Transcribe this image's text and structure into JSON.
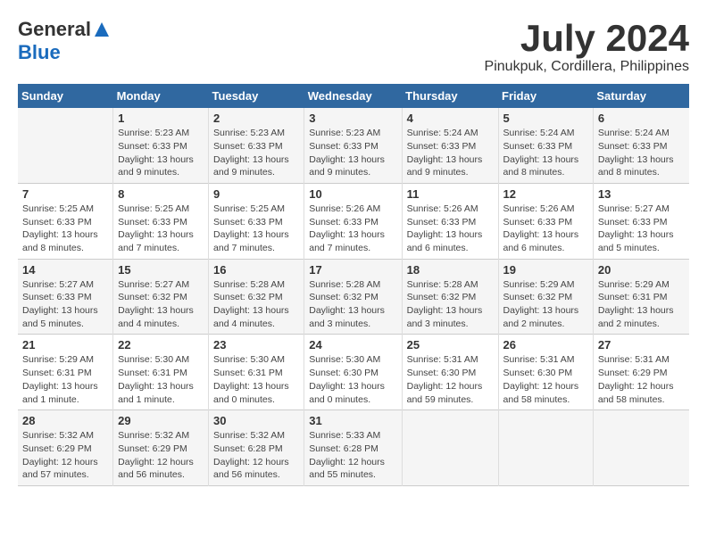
{
  "header": {
    "logo_general": "General",
    "logo_blue": "Blue",
    "month_title": "July 2024",
    "location": "Pinukpuk, Cordillera, Philippines"
  },
  "days_of_week": [
    "Sunday",
    "Monday",
    "Tuesday",
    "Wednesday",
    "Thursday",
    "Friday",
    "Saturday"
  ],
  "weeks": [
    [
      {
        "day": "",
        "info": ""
      },
      {
        "day": "1",
        "info": "Sunrise: 5:23 AM\nSunset: 6:33 PM\nDaylight: 13 hours\nand 9 minutes."
      },
      {
        "day": "2",
        "info": "Sunrise: 5:23 AM\nSunset: 6:33 PM\nDaylight: 13 hours\nand 9 minutes."
      },
      {
        "day": "3",
        "info": "Sunrise: 5:23 AM\nSunset: 6:33 PM\nDaylight: 13 hours\nand 9 minutes."
      },
      {
        "day": "4",
        "info": "Sunrise: 5:24 AM\nSunset: 6:33 PM\nDaylight: 13 hours\nand 9 minutes."
      },
      {
        "day": "5",
        "info": "Sunrise: 5:24 AM\nSunset: 6:33 PM\nDaylight: 13 hours\nand 8 minutes."
      },
      {
        "day": "6",
        "info": "Sunrise: 5:24 AM\nSunset: 6:33 PM\nDaylight: 13 hours\nand 8 minutes."
      }
    ],
    [
      {
        "day": "7",
        "info": "Sunrise: 5:25 AM\nSunset: 6:33 PM\nDaylight: 13 hours\nand 8 minutes."
      },
      {
        "day": "8",
        "info": "Sunrise: 5:25 AM\nSunset: 6:33 PM\nDaylight: 13 hours\nand 7 minutes."
      },
      {
        "day": "9",
        "info": "Sunrise: 5:25 AM\nSunset: 6:33 PM\nDaylight: 13 hours\nand 7 minutes."
      },
      {
        "day": "10",
        "info": "Sunrise: 5:26 AM\nSunset: 6:33 PM\nDaylight: 13 hours\nand 7 minutes."
      },
      {
        "day": "11",
        "info": "Sunrise: 5:26 AM\nSunset: 6:33 PM\nDaylight: 13 hours\nand 6 minutes."
      },
      {
        "day": "12",
        "info": "Sunrise: 5:26 AM\nSunset: 6:33 PM\nDaylight: 13 hours\nand 6 minutes."
      },
      {
        "day": "13",
        "info": "Sunrise: 5:27 AM\nSunset: 6:33 PM\nDaylight: 13 hours\nand 5 minutes."
      }
    ],
    [
      {
        "day": "14",
        "info": "Sunrise: 5:27 AM\nSunset: 6:33 PM\nDaylight: 13 hours\nand 5 minutes."
      },
      {
        "day": "15",
        "info": "Sunrise: 5:27 AM\nSunset: 6:32 PM\nDaylight: 13 hours\nand 4 minutes."
      },
      {
        "day": "16",
        "info": "Sunrise: 5:28 AM\nSunset: 6:32 PM\nDaylight: 13 hours\nand 4 minutes."
      },
      {
        "day": "17",
        "info": "Sunrise: 5:28 AM\nSunset: 6:32 PM\nDaylight: 13 hours\nand 3 minutes."
      },
      {
        "day": "18",
        "info": "Sunrise: 5:28 AM\nSunset: 6:32 PM\nDaylight: 13 hours\nand 3 minutes."
      },
      {
        "day": "19",
        "info": "Sunrise: 5:29 AM\nSunset: 6:32 PM\nDaylight: 13 hours\nand 2 minutes."
      },
      {
        "day": "20",
        "info": "Sunrise: 5:29 AM\nSunset: 6:31 PM\nDaylight: 13 hours\nand 2 minutes."
      }
    ],
    [
      {
        "day": "21",
        "info": "Sunrise: 5:29 AM\nSunset: 6:31 PM\nDaylight: 13 hours\nand 1 minute."
      },
      {
        "day": "22",
        "info": "Sunrise: 5:30 AM\nSunset: 6:31 PM\nDaylight: 13 hours\nand 1 minute."
      },
      {
        "day": "23",
        "info": "Sunrise: 5:30 AM\nSunset: 6:31 PM\nDaylight: 13 hours\nand 0 minutes."
      },
      {
        "day": "24",
        "info": "Sunrise: 5:30 AM\nSunset: 6:30 PM\nDaylight: 13 hours\nand 0 minutes."
      },
      {
        "day": "25",
        "info": "Sunrise: 5:31 AM\nSunset: 6:30 PM\nDaylight: 12 hours\nand 59 minutes."
      },
      {
        "day": "26",
        "info": "Sunrise: 5:31 AM\nSunset: 6:30 PM\nDaylight: 12 hours\nand 58 minutes."
      },
      {
        "day": "27",
        "info": "Sunrise: 5:31 AM\nSunset: 6:29 PM\nDaylight: 12 hours\nand 58 minutes."
      }
    ],
    [
      {
        "day": "28",
        "info": "Sunrise: 5:32 AM\nSunset: 6:29 PM\nDaylight: 12 hours\nand 57 minutes."
      },
      {
        "day": "29",
        "info": "Sunrise: 5:32 AM\nSunset: 6:29 PM\nDaylight: 12 hours\nand 56 minutes."
      },
      {
        "day": "30",
        "info": "Sunrise: 5:32 AM\nSunset: 6:28 PM\nDaylight: 12 hours\nand 56 minutes."
      },
      {
        "day": "31",
        "info": "Sunrise: 5:33 AM\nSunset: 6:28 PM\nDaylight: 12 hours\nand 55 minutes."
      },
      {
        "day": "",
        "info": ""
      },
      {
        "day": "",
        "info": ""
      },
      {
        "day": "",
        "info": ""
      }
    ]
  ]
}
